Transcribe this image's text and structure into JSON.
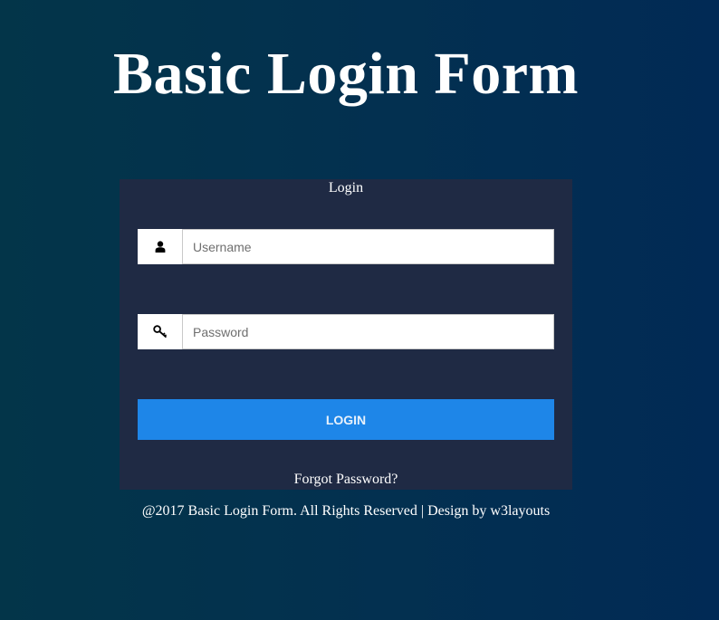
{
  "page": {
    "title": "Basic Login Form"
  },
  "form": {
    "heading": "Login",
    "username": {
      "placeholder": "Username",
      "value": "",
      "icon": "user-icon"
    },
    "password": {
      "placeholder": "Password",
      "value": "",
      "icon": "key-icon"
    },
    "login_label": "LOGIN",
    "forgot_label": "Forgot Password?"
  },
  "footer": {
    "text": "@2017 Basic Login Form. All Rights Reserved | Design by w3layouts"
  },
  "colors": {
    "background": "#03334f",
    "panel": "#1f2a44",
    "button": "#1e86e8",
    "text": "#ffffff"
  }
}
